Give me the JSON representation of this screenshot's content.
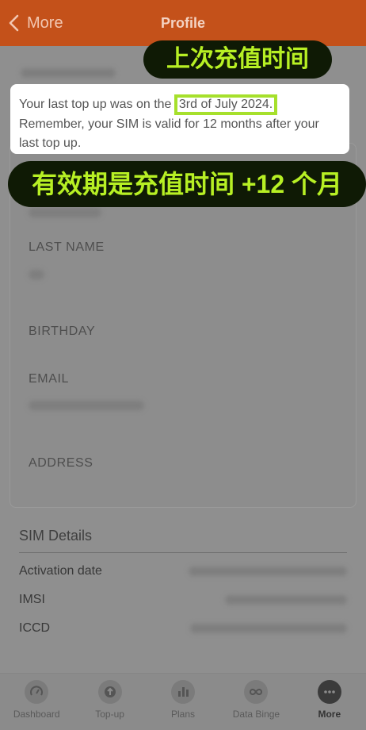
{
  "header": {
    "back_label": "More",
    "title": "Profile"
  },
  "notice": {
    "text_before": "Your last top up was on the ",
    "date": "3rd of July 2024.",
    "text_after": "Remember, your SIM is valid for 12 months after your last top up."
  },
  "annotations": {
    "top": "上次充值时间",
    "middle": "有效期是充值时间 +12 个月"
  },
  "profile_fields": {
    "last_name": "LAST NAME",
    "birthday": "BIRTHDAY",
    "email": "EMAIL",
    "address": "ADDRESS"
  },
  "sim": {
    "title": "SIM Details",
    "activation": "Activation date",
    "imsi": "IMSI",
    "iccd": "ICCD"
  },
  "nav": [
    {
      "label": "Dashboard",
      "icon": "speedometer-icon"
    },
    {
      "label": "Top-up",
      "icon": "topup-icon"
    },
    {
      "label": "Plans",
      "icon": "bar-chart-icon"
    },
    {
      "label": "Data Binge",
      "icon": "infinity-icon"
    },
    {
      "label": "More",
      "icon": "more-dots-icon"
    }
  ],
  "colors": {
    "header": "#c4511a",
    "highlight": "#a6e02c",
    "annotation_text": "#b7f024",
    "annotation_bg": "#0f1a05"
  }
}
